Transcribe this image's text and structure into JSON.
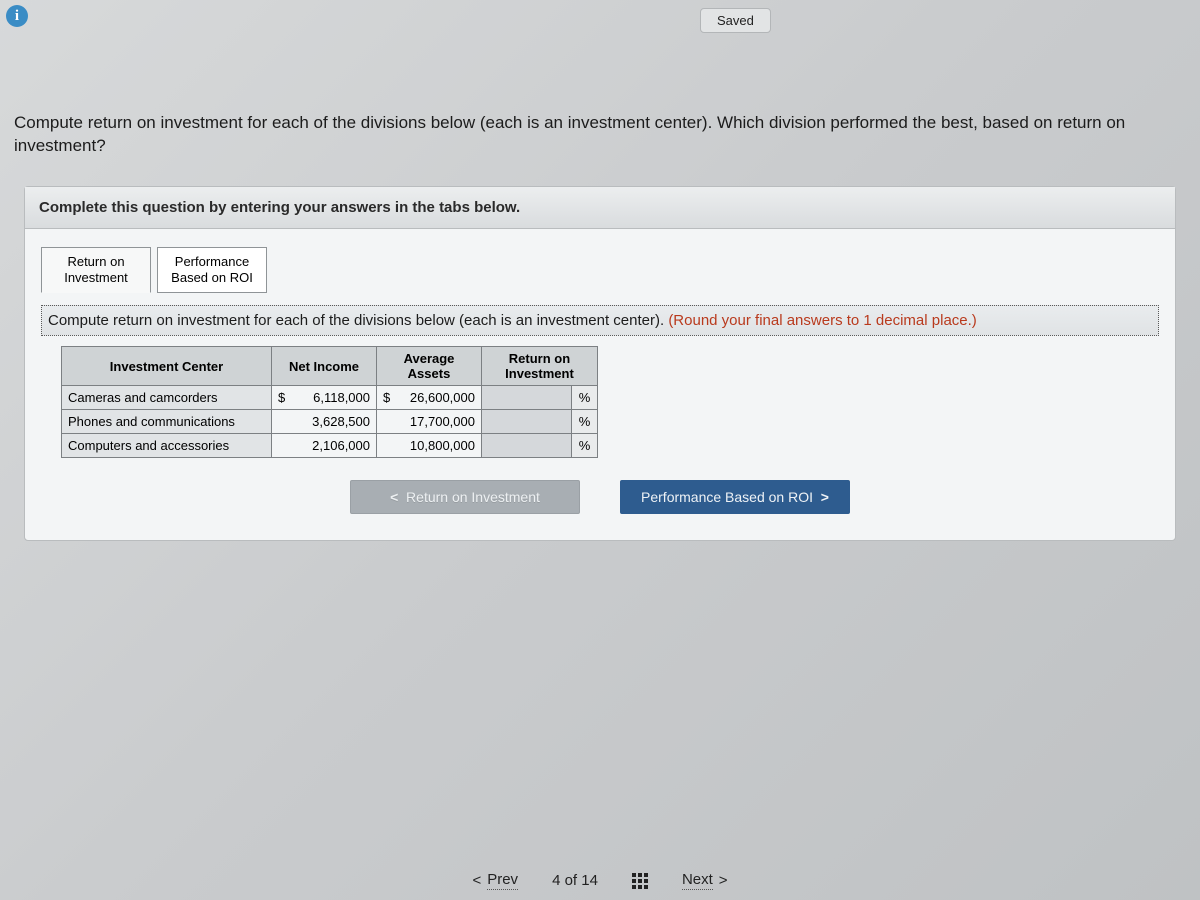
{
  "top": {
    "saved_label": "Saved",
    "info_glyph": "i"
  },
  "question": {
    "prompt": "Compute return on investment for each of the divisions below (each is an investment center). Which division performed the best, based on return on investment?"
  },
  "panel": {
    "header": "Complete this question by entering your answers in the tabs below."
  },
  "tabs": {
    "roi_l1": "Return on",
    "roi_l2": "Investment",
    "perf_l1": "Performance",
    "perf_l2": "Based on ROI"
  },
  "subprompt": {
    "text": "Compute return on investment for each of the divisions below (each is an investment center). ",
    "hint": "(Round your final answers to 1 decimal place.)"
  },
  "table": {
    "headers": {
      "center": "Investment Center",
      "income": "Net Income",
      "assets": "Average Assets",
      "roi_l1": "Return on",
      "roi_l2": "Investment"
    },
    "rows": [
      {
        "center": "Cameras and camcorders",
        "income_cur": "$",
        "income": "6,118,000",
        "assets_cur": "$",
        "assets": "26,600,000",
        "roi": "",
        "pct": "%"
      },
      {
        "center": "Phones and communications",
        "income_cur": "",
        "income": "3,628,500",
        "assets_cur": "",
        "assets": "17,700,000",
        "roi": "",
        "pct": "%"
      },
      {
        "center": "Computers and accessories",
        "income_cur": "",
        "income": "2,106,000",
        "assets_cur": "",
        "assets": "10,800,000",
        "roi": "",
        "pct": "%"
      }
    ]
  },
  "navbtns": {
    "prev_chev": "<",
    "prev_label": "Return on Investment",
    "next_label": "Performance Based on ROI",
    "next_chev": ">"
  },
  "bottom": {
    "prev_chev": "<",
    "prev": "Prev",
    "counter": "4 of 14",
    "next": "Next",
    "next_chev": ">"
  }
}
